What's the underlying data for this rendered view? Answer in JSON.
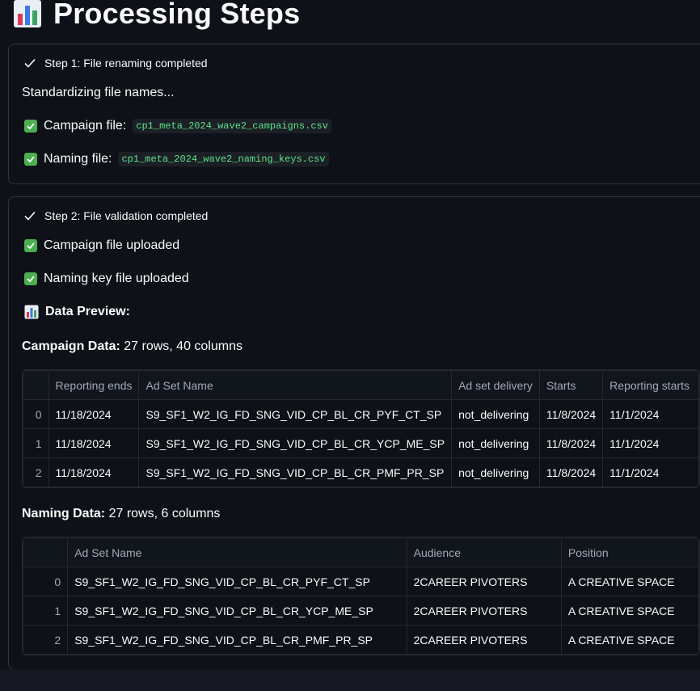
{
  "page": {
    "title": "Processing Steps"
  },
  "step1": {
    "header": "Step 1: File renaming completed",
    "intro": "Standardizing file names...",
    "campaign_label": "Campaign file:",
    "campaign_file": "cp1_meta_2024_wave2_campaigns.csv",
    "naming_label": "Naming file:",
    "naming_file": "cp1_meta_2024_wave2_naming_keys.csv"
  },
  "step2": {
    "header": "Step 2: File validation completed",
    "campaign_uploaded": "Campaign file uploaded",
    "naming_uploaded": "Naming key file uploaded",
    "preview_title": "Data Preview:",
    "campaign_data_label": "Campaign Data:",
    "campaign_data_info": "27 rows, 40 columns",
    "naming_data_label": "Naming Data:",
    "naming_data_info": "27 rows, 6 columns"
  },
  "campaign_table": {
    "columns": [
      "",
      "Reporting ends",
      "Ad Set Name",
      "Ad set delivery",
      "Starts",
      "Reporting starts"
    ],
    "rows": [
      [
        "0",
        "11/18/2024",
        "S9_SF1_W2_IG_FD_SNG_VID_CP_BL_CR_PYF_CT_SP",
        "not_delivering",
        "11/8/2024",
        "11/1/2024"
      ],
      [
        "1",
        "11/18/2024",
        "S9_SF1_W2_IG_FD_SNG_VID_CP_BL_CR_YCP_ME_SP",
        "not_delivering",
        "11/8/2024",
        "11/1/2024"
      ],
      [
        "2",
        "11/18/2024",
        "S9_SF1_W2_IG_FD_SNG_VID_CP_BL_CR_PMF_PR_SP",
        "not_delivering",
        "11/8/2024",
        "11/1/2024"
      ]
    ]
  },
  "naming_table": {
    "columns": [
      "",
      "Ad Set Name",
      "Audience",
      "Position"
    ],
    "rows": [
      [
        "0",
        "S9_SF1_W2_IG_FD_SNG_VID_CP_BL_CR_PYF_CT_SP",
        "2CAREER PIVOTERS",
        "A CREATIVE SPACE"
      ],
      [
        "1",
        "S9_SF1_W2_IG_FD_SNG_VID_CP_BL_CR_YCP_ME_SP",
        "2CAREER PIVOTERS",
        "A CREATIVE SPACE"
      ],
      [
        "2",
        "S9_SF1_W2_IG_FD_SNG_VID_CP_BL_CR_PMF_PR_SP",
        "2CAREER PIVOTERS",
        "A CREATIVE SPACE"
      ]
    ]
  },
  "icons": {
    "title_icon": "bar-chart-icon",
    "step_icon": "checkmark-icon",
    "item_icon": "check-box-icon"
  },
  "colors": {
    "background": "#0e1117",
    "check_green": "#4caf50",
    "code_green": "#5ce488",
    "border": "#31333f"
  }
}
